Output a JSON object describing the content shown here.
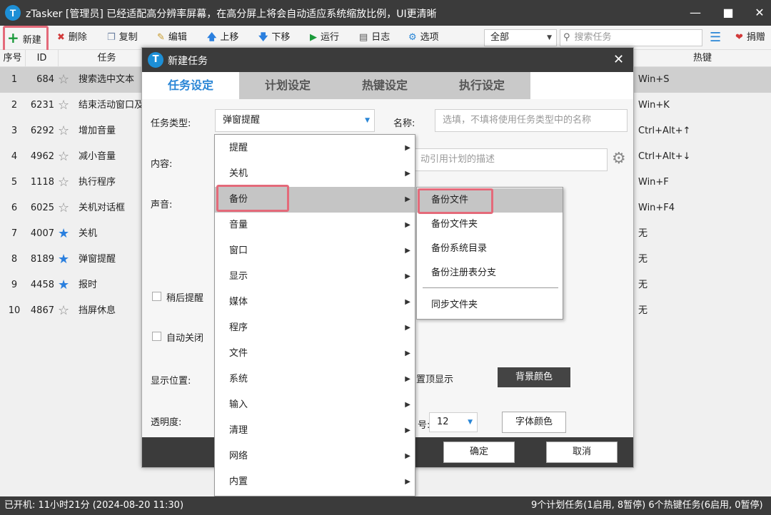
{
  "window": {
    "title": "zTasker [管理员]  已经适配高分辨率屏幕，在高分屏上将会自动适应系统缩放比例，UI更清晰",
    "logo_letter": "T"
  },
  "toolbar": {
    "new": "新建",
    "delete": "删除",
    "copy": "复制",
    "edit": "编辑",
    "move_up": "上移",
    "move_down": "下移",
    "run": "运行",
    "log": "日志",
    "options": "选项",
    "filter_value": "全部",
    "search_placeholder": "搜索任务",
    "donate": "捐赠"
  },
  "table": {
    "headers": {
      "seq": "序号",
      "id": "ID",
      "task": "任务",
      "hotkey": "热键"
    },
    "rows": [
      {
        "seq": "1",
        "id": "684",
        "task": "搜索选中文本",
        "hotkey": "Win+S",
        "starred": false,
        "selected": true
      },
      {
        "seq": "2",
        "id": "6231",
        "task": "结束活动窗口及",
        "hotkey": "Win+K",
        "starred": false
      },
      {
        "seq": "3",
        "id": "6292",
        "task": "增加音量",
        "hotkey": "Ctrl+Alt+↑",
        "starred": false
      },
      {
        "seq": "4",
        "id": "4962",
        "task": "减小音量",
        "hotkey": "Ctrl+Alt+↓",
        "starred": false
      },
      {
        "seq": "5",
        "id": "1118",
        "task": "执行程序",
        "hotkey": "Win+F",
        "starred": false
      },
      {
        "seq": "6",
        "id": "6025",
        "task": "关机对话框",
        "hotkey": "Win+F4",
        "starred": false
      },
      {
        "seq": "7",
        "id": "4007",
        "task": "关机",
        "hotkey": "无",
        "starred": true
      },
      {
        "seq": "8",
        "id": "8189",
        "task": "弹窗提醒",
        "hotkey": "无",
        "starred": true
      },
      {
        "seq": "9",
        "id": "4458",
        "task": "报时",
        "hotkey": "无",
        "starred": true
      },
      {
        "seq": "10",
        "id": "4867",
        "task": "挡屏休息",
        "hotkey": "无",
        "starred": false
      }
    ]
  },
  "dialog": {
    "title": "新建任务",
    "tabs": [
      "任务设定",
      "计划设定",
      "热键设定",
      "执行设定"
    ],
    "labels": {
      "task_type": "任务类型:",
      "name": "名称:",
      "content": "内容:",
      "sound": "声音:",
      "remind_later": "稍后提醒",
      "auto_close": "自动关闭",
      "display_pos": "显示位置:",
      "opacity": "透明度:",
      "topmost": "置顶显示",
      "font_size_partial": "号:"
    },
    "task_type_value": "弹窗提醒",
    "name_placeholder": "选填，不填将使用任务类型中的名称",
    "content_placeholder_partial": "动引用计划的描述",
    "font_size_value": "12",
    "bg_color_button": "背景颜色",
    "font_color_button": "字体颜色",
    "ok": "确定",
    "cancel": "取消"
  },
  "type_menu": {
    "items": [
      "提醒",
      "关机",
      "备份",
      "音量",
      "窗口",
      "显示",
      "媒体",
      "程序",
      "文件",
      "系统",
      "输入",
      "清理",
      "网络",
      "内置"
    ],
    "highlighted_index": 2
  },
  "backup_submenu": {
    "items": [
      "备份文件",
      "备份文件夹",
      "备份系统目录",
      "备份注册表分支"
    ],
    "extra_item": "同步文件夹",
    "highlighted_index": 0
  },
  "status": {
    "uptime": "已开机:  11小时21分 (2024-08-20 11:30)",
    "summary": "9个计划任务(1启用, 8暂停)  6个热键任务(6启用, 0暂停)"
  },
  "colors": {
    "accent": "#2a86d6",
    "highlight_border": "#e46a7a",
    "dark": "#3b3b3b"
  }
}
